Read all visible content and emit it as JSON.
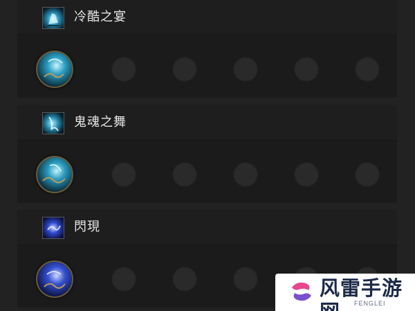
{
  "skills": [
    {
      "name": "冷酷之宴",
      "icon": "cold-feast-skill-icon",
      "color": "#3ab6d6"
    },
    {
      "name": "鬼魂之舞",
      "icon": "ghost-dance-skill-icon",
      "color": "#42b4cf"
    },
    {
      "name": "閃現",
      "icon": "blink-skill-icon",
      "color": "#3c5bd6"
    }
  ],
  "empty_slots_per_row": 5,
  "watermark": {
    "title": "风雷手游网",
    "subtitle": "FENGLEI",
    "logo_icon": "fenglei-logo-icon",
    "colors": {
      "pink": "#e8468a",
      "purple": "#7a4fd0",
      "navy": "#1c2a48"
    }
  }
}
